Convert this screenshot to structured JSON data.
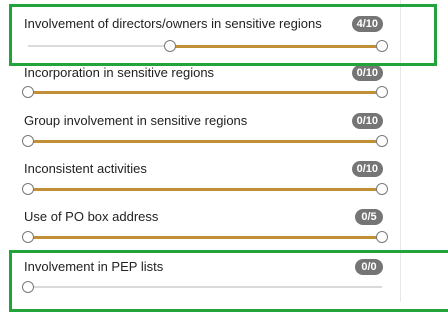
{
  "colors": {
    "range_fill": "#c18f36",
    "track": "#dadada",
    "badge_bg": "#757575",
    "highlight_border": "#22a33c"
  },
  "rows": [
    {
      "label": "Involvement of directors/owners in sensitive regions",
      "badge": "4/10",
      "range": {
        "min": 0,
        "max": 10,
        "low": 4,
        "high": 10
      }
    },
    {
      "label": "Incorporation in sensitive regions",
      "badge": "0/10",
      "range": {
        "min": 0,
        "max": 10,
        "low": 0,
        "high": 10
      }
    },
    {
      "label": "Group involvement in sensitive regions",
      "badge": "0/10",
      "range": {
        "min": 0,
        "max": 10,
        "low": 0,
        "high": 10
      }
    },
    {
      "label": "Inconsistent activities",
      "badge": "0/10",
      "range": {
        "min": 0,
        "max": 10,
        "low": 0,
        "high": 10
      }
    },
    {
      "label": "Use of PO box address",
      "badge": "0/5",
      "range": {
        "min": 0,
        "max": 5,
        "low": 0,
        "high": 5
      }
    },
    {
      "label": "Involvement in PEP lists",
      "badge": "0/0",
      "range": {
        "min": 0,
        "max": 0,
        "low": 0,
        "high": 0
      }
    }
  ]
}
